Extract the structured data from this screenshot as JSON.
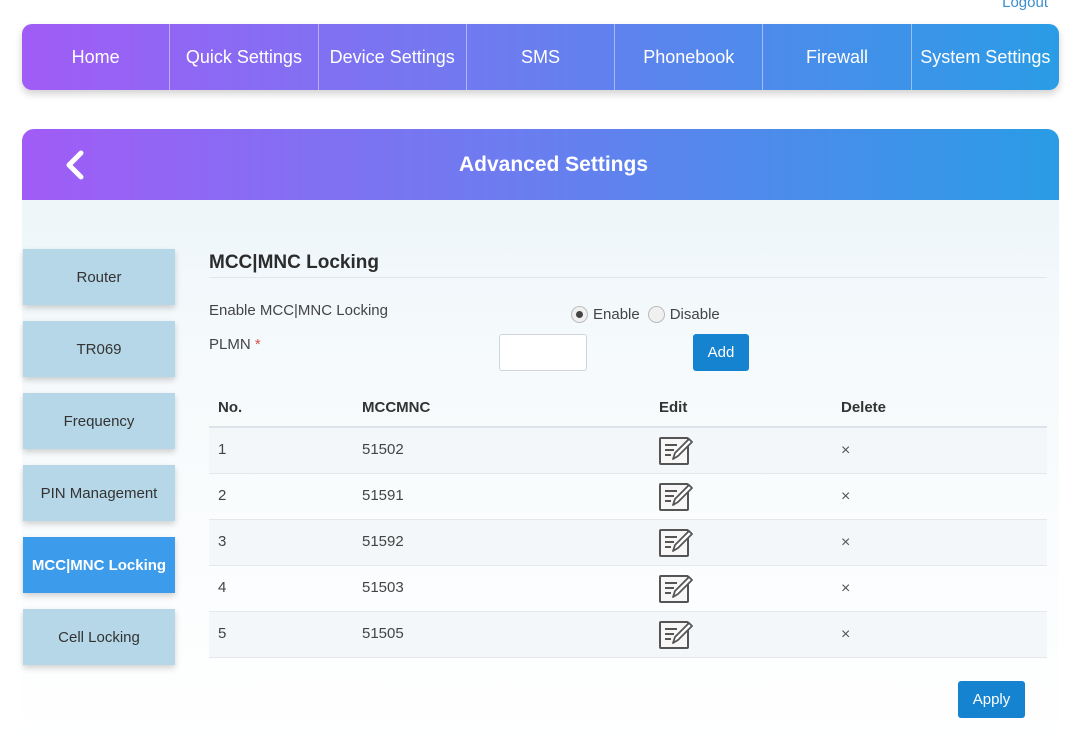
{
  "header": {
    "logout_label": "Logout"
  },
  "nav": {
    "items": [
      {
        "label": "Home"
      },
      {
        "label": "Quick Settings"
      },
      {
        "label": "Device Settings"
      },
      {
        "label": "SMS"
      },
      {
        "label": "Phonebook"
      },
      {
        "label": "Firewall"
      },
      {
        "label": "System Settings"
      }
    ]
  },
  "panel": {
    "title": "Advanced Settings",
    "back_icon": "chevron-left-icon"
  },
  "sidebar": {
    "items": [
      {
        "label": "Router"
      },
      {
        "label": "TR069"
      },
      {
        "label": "Frequency"
      },
      {
        "label": "PIN Management"
      },
      {
        "label": "MCC|MNC Locking",
        "active": true
      },
      {
        "label": "Cell Locking"
      }
    ]
  },
  "main": {
    "section_title": "MCC|MNC Locking",
    "enable_label": "Enable MCC|MNC Locking",
    "enable_option": "Enable",
    "disable_option": "Disable",
    "selected_option": "Enable",
    "plmn_label": "PLMN",
    "required_marker": "*",
    "plmn_value": "",
    "add_label": "Add",
    "apply_label": "Apply",
    "table": {
      "headers": {
        "no": "No.",
        "mccmnc": "MCCMNC",
        "edit": "Edit",
        "delete": "Delete"
      },
      "rows": [
        {
          "no": "1",
          "mccmnc": "51502"
        },
        {
          "no": "2",
          "mccmnc": "51591"
        },
        {
          "no": "3",
          "mccmnc": "51592"
        },
        {
          "no": "4",
          "mccmnc": "51503"
        },
        {
          "no": "5",
          "mccmnc": "51505"
        }
      ],
      "delete_glyph": "×"
    }
  },
  "colors": {
    "gradient_start": "#a15cf6",
    "gradient_end": "#2a9ce6",
    "primary_button": "#1583d0",
    "sidebar_item": "#b6d7e8",
    "sidebar_active": "#3c9bea"
  }
}
